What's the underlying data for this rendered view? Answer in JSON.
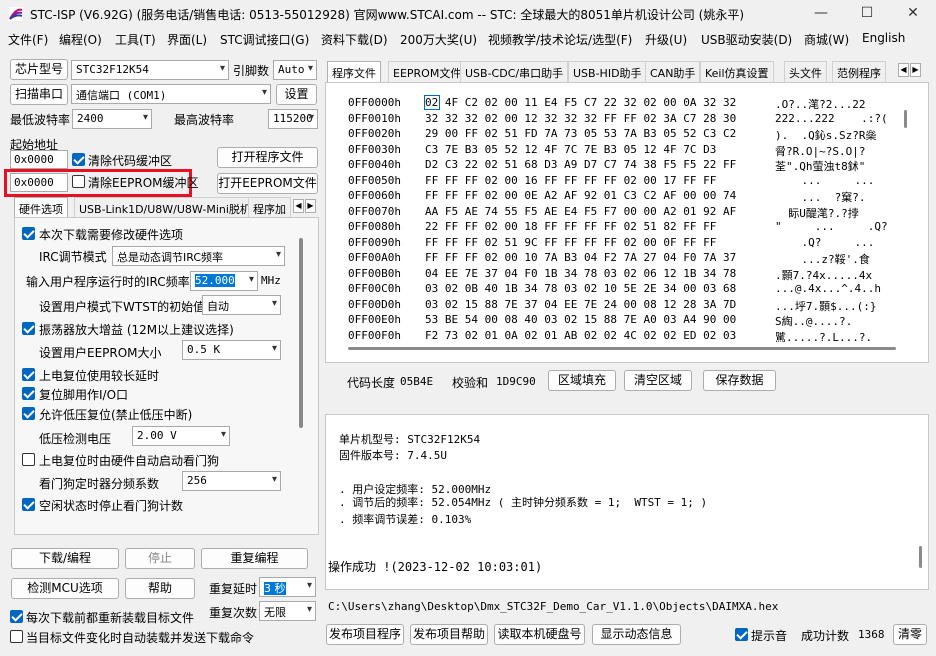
{
  "window": {
    "title": "STC-ISP (V6.92G) (服务电话/销售电话: 0513-55012928) 官网www.STCAI.com  -- STC: 全球最大的8051单片机设计公司 (姚永平)",
    "minimize": "—",
    "maximize": "☐",
    "close": "✕"
  },
  "menu": [
    "文件(F)",
    "编程(O)",
    "工具(T)",
    "界面(L)",
    "STC调试接口(G)",
    "资料下载(D)",
    "200万大奖(U)",
    "视频教学/技术论坛/选型(F)",
    "升级(U)",
    "USB驱动安装(D)",
    "商城(W)",
    "English"
  ],
  "left": {
    "chip_label": "芯片型号",
    "chip_value": "STC32F12K54",
    "pin_label": "引脚数",
    "pin_value": "Auto",
    "scan_button": "扫描串口",
    "port_value": "通信端口 (COM1)",
    "settings_button": "设置",
    "min_baud_label": "最低波特率",
    "min_baud_value": "2400",
    "max_baud_label": "最高波特率",
    "max_baud_value": "115200",
    "start_addr_label": "起始地址",
    "code_addr": "0x0000",
    "clear_code_label": "清除代码缓冲区",
    "open_prog_button": "打开程序文件",
    "eeprom_addr": "0x0000",
    "clear_eeprom_label": "清除EEPROM缓冲区",
    "open_eeprom_button": "打开EEPROM文件",
    "tabs": [
      "硬件选项",
      "USB-Link1D/U8W/U8W-Mini脱机",
      "程序加"
    ],
    "options": {
      "need_modify": "本次下载需要修改硬件选项",
      "irc_mode_label": "IRC调节模式",
      "irc_mode_value": "总是动态调节IRC频率",
      "irc_freq_label": "输入用户程序运行时的IRC频率",
      "irc_freq_value": "52.000",
      "irc_freq_unit": "MHz",
      "wtst_label": "设置用户模式下WTST的初始值",
      "wtst_value": "自动",
      "osc_gain": "振荡器放大增益 (12M以上建议选择)",
      "eeprom_size_label": "设置用户EEPROM大小",
      "eeprom_size_value": "0.5 K",
      "power_delay": "上电复位使用较长延时",
      "reset_pin": "复位脚用作I/O口",
      "lvd_reset": "允许低压复位(禁止低压中断)",
      "lvd_label": "低压检测电压",
      "lvd_value": "2.00 V",
      "wdt_auto": "上电复位时由硬件自动启动看门狗",
      "wdt_div_label": "看门狗定时器分频系数",
      "wdt_div_value": "256",
      "idle_stop_wdt": "空闲状态时停止看门狗计数"
    },
    "download_button": "下载/编程",
    "stop_button": "停止",
    "reprogram_button": "重复编程",
    "check_mcu_button": "检测MCU选项",
    "help_button": "帮助",
    "repeat_delay_label": "重复延时",
    "repeat_delay_value": "3 秒",
    "repeat_count_label": "重复次数",
    "repeat_count_value": "无限",
    "reload_each": "每次下载前都重新装载目标文件",
    "auto_reload": "当目标文件变化时自动装载并发送下载命令"
  },
  "right": {
    "tabs": [
      "程序文件",
      "EEPROM文件",
      "USB-CDC/串口助手",
      "USB-HID助手",
      "CAN助手",
      "Keil仿真设置",
      "头文件",
      "范例程序"
    ],
    "hex_rows": [
      {
        "addr": "0FF0000h",
        "bytes": "02 4F C2 02 00 11 E4 F5 C7 22 32 02 00 0A 32 32",
        "ascii": ".O?..滗?2...22"
      },
      {
        "addr": "0FF0010h",
        "bytes": "32 32 32 02 00 12 32 32 32 FF FF 02 3A C7 28 30",
        "ascii": "222...222    .:?("
      },
      {
        "addr": "0FF0020h",
        "bytes": "29 00 FF 02 51 FD 7A 73 05 53 7A B3 05 52 C3 C2",
        "ascii": ").  .Q鈊s.Sz?R橤"
      },
      {
        "addr": "0FF0030h",
        "bytes": "C3 7E B3 05 52 12 4F 7C 7E B3 05 12 4F 7C D3",
        "ascii": "脋?R.O|~?S.O|?"
      },
      {
        "addr": "0FF0040h",
        "bytes": "D2 C3 22 02 51 68 D3 A9 D7 C7 74 38 F5 F5 22 FF",
        "ascii": "荃\".Qh萤浊t8鉥\""
      },
      {
        "addr": "0FF0050h",
        "bytes": "FF FF FF 02 00 16 FF FF FF FF 02 00 17 FF FF",
        "ascii": "    ...     ..."
      },
      {
        "addr": "0FF0060h",
        "bytes": "FF FF FF 02 00 0E A2 AF 92 01 C3 C2 AF 00 00 74",
        "ascii": "    ...  ?窠?."
      },
      {
        "addr": "0FF0070h",
        "bytes": "AA F5 AE 74 55 F5 AE E4 F5 F7 00 00 A2 01 92 AF",
        "ascii": "  眎U醍滗?.?挬"
      },
      {
        "addr": "0FF0080h",
        "bytes": "22 FF FF 02 00 18 FF FF FF FF 02 51 82 FF FF",
        "ascii": "\"     ...     .Q?"
      },
      {
        "addr": "0FF0090h",
        "bytes": "FF FF FF 02 51 9C FF FF FF FF 02 00 0F FF FF",
        "ascii": "    .Q?     ..."
      },
      {
        "addr": "0FF00A0h",
        "bytes": "FF FF FF 02 00 10 7A B3 04 F2 7A 27 04 F0 7A 37",
        "ascii": "    ...z?鞖'.食"
      },
      {
        "addr": "0FF00B0h",
        "bytes": "04 EE 7E 37 04 F0 1B 34 78 03 02 06 12 1B 34 78",
        "ascii": ".顥7.?4x.....4x"
      },
      {
        "addr": "0FF00C0h",
        "bytes": "03 02 0B 40 1B 34 78 03 02 10 5E 2E 34 00 03 68",
        "ascii": "...@.4x...^.4..h"
      },
      {
        "addr": "0FF00D0h",
        "bytes": "03 02 15 88 7E 37 04 EE 7E 24 00 08 12 28 3A 7D",
        "ascii": "...垀7.顥$...(:}"
      },
      {
        "addr": "0FF00E0h",
        "bytes": "53 BE 54 00 08 40 03 02 15 88 7E A0 03 A4 90 00",
        "ascii": "S綯..@....?.  "
      },
      {
        "addr": "0FF00F0h",
        "bytes": "F2 73 02 01 0A 02 01 AB 02 02 4C 02 02 ED 02 03",
        "ascii": "騭.....?.L...?."
      }
    ],
    "code_len_label": "代码长度",
    "code_len_value": "05B4E",
    "checksum_label": "校验和",
    "checksum_value": "1D9C90",
    "fill_button": "区域填充",
    "clear_button": "清空区域",
    "save_button": "保存数据",
    "log_lines": [
      "单片机型号: STC32F12K54",
      "固件版本号: 7.4.5U",
      "",
      ". 用户设定频率: 52.000MHz",
      ". 调节后的频率: 52.054MHz ( 主时钟分频系数 = 1;  WTST = 1; )",
      ". 频率调节误差: 0.103%",
      "",
      "",
      "操作成功 !(2023-12-02 10:03:01)"
    ],
    "filepath": "C:\\Users\\zhang\\Desktop\\Dmx_STC32F_Demo_Car_V1.1.0\\Objects\\DAIMXA.hex",
    "publish_prog": "发布项目程序",
    "publish_help": "发布项目帮助",
    "read_serial": "读取本机硬盘号",
    "show_dynamic": "显示动态信息",
    "beep_label": "提示音",
    "success_label": "成功计数",
    "success_value": "1368",
    "clear_count": "清零"
  },
  "colors": {
    "highlight": "#e81123",
    "accent": "#0067c0",
    "selection": "#0078d7"
  }
}
